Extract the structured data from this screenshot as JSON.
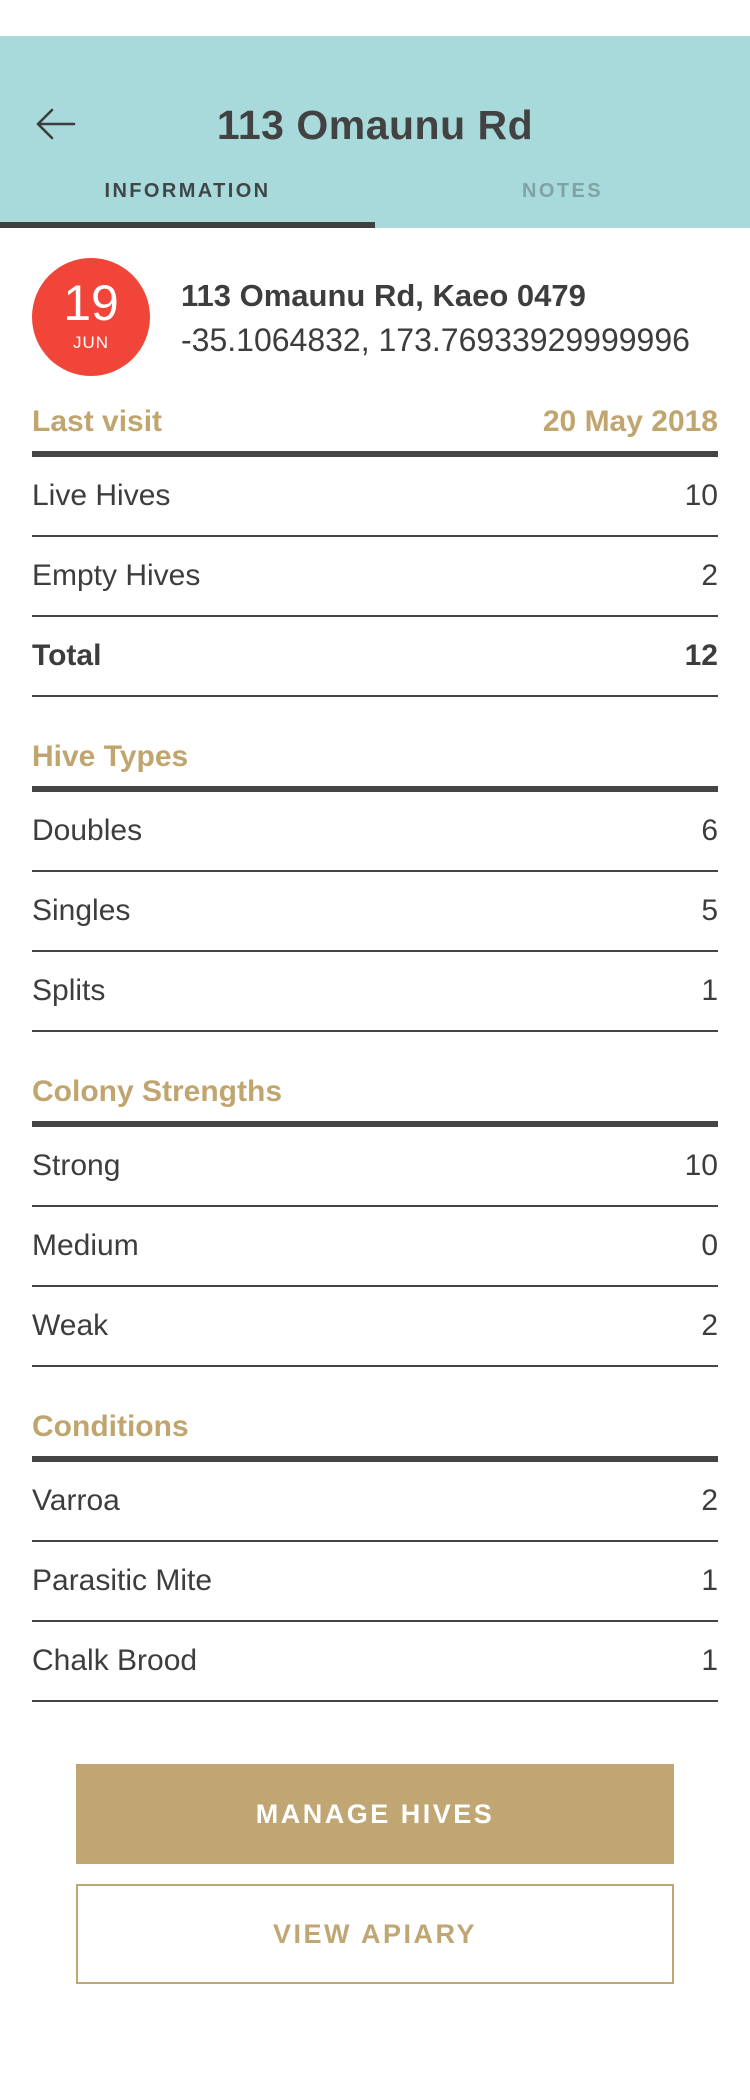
{
  "header": {
    "title": "113 Omaunu Rd",
    "back_icon": "arrow-left-icon",
    "background": "#a9dadb"
  },
  "tabs": [
    {
      "label": "INFORMATION",
      "active": true
    },
    {
      "label": "NOTES",
      "active": false
    }
  ],
  "summary": {
    "date_day": "19",
    "date_month": "JUN",
    "address": "113 Omaunu Rd, Kaeo 0479",
    "coordinates": "-35.1064832, 173.76933929999996",
    "badge_color": "#f04538"
  },
  "sections": {
    "last_visit": {
      "heading": "Last visit",
      "heading_value": "20 May 2018",
      "rows": [
        {
          "label": "Live Hives",
          "value": "10"
        },
        {
          "label": "Empty Hives",
          "value": "2"
        },
        {
          "label": "Total",
          "value": "12"
        }
      ]
    },
    "hive_types": {
      "heading": "Hive Types",
      "rows": [
        {
          "label": "Doubles",
          "value": "6"
        },
        {
          "label": "Singles",
          "value": "5"
        },
        {
          "label": "Splits",
          "value": "1"
        }
      ]
    },
    "colony_strengths": {
      "heading": "Colony Strengths",
      "rows": [
        {
          "label": "Strong",
          "value": "10"
        },
        {
          "label": "Medium",
          "value": "0"
        },
        {
          "label": "Weak",
          "value": "2"
        }
      ]
    },
    "conditions": {
      "heading": "Conditions",
      "rows": [
        {
          "label": "Varroa",
          "value": "2"
        },
        {
          "label": "Parasitic Mite",
          "value": "1"
        },
        {
          "label": "Chalk Brood",
          "value": "1"
        }
      ]
    }
  },
  "actions": {
    "manage_hives": "MANAGE HIVES",
    "view_apiary": "VIEW APIARY",
    "accent_color": "#bfa673"
  }
}
